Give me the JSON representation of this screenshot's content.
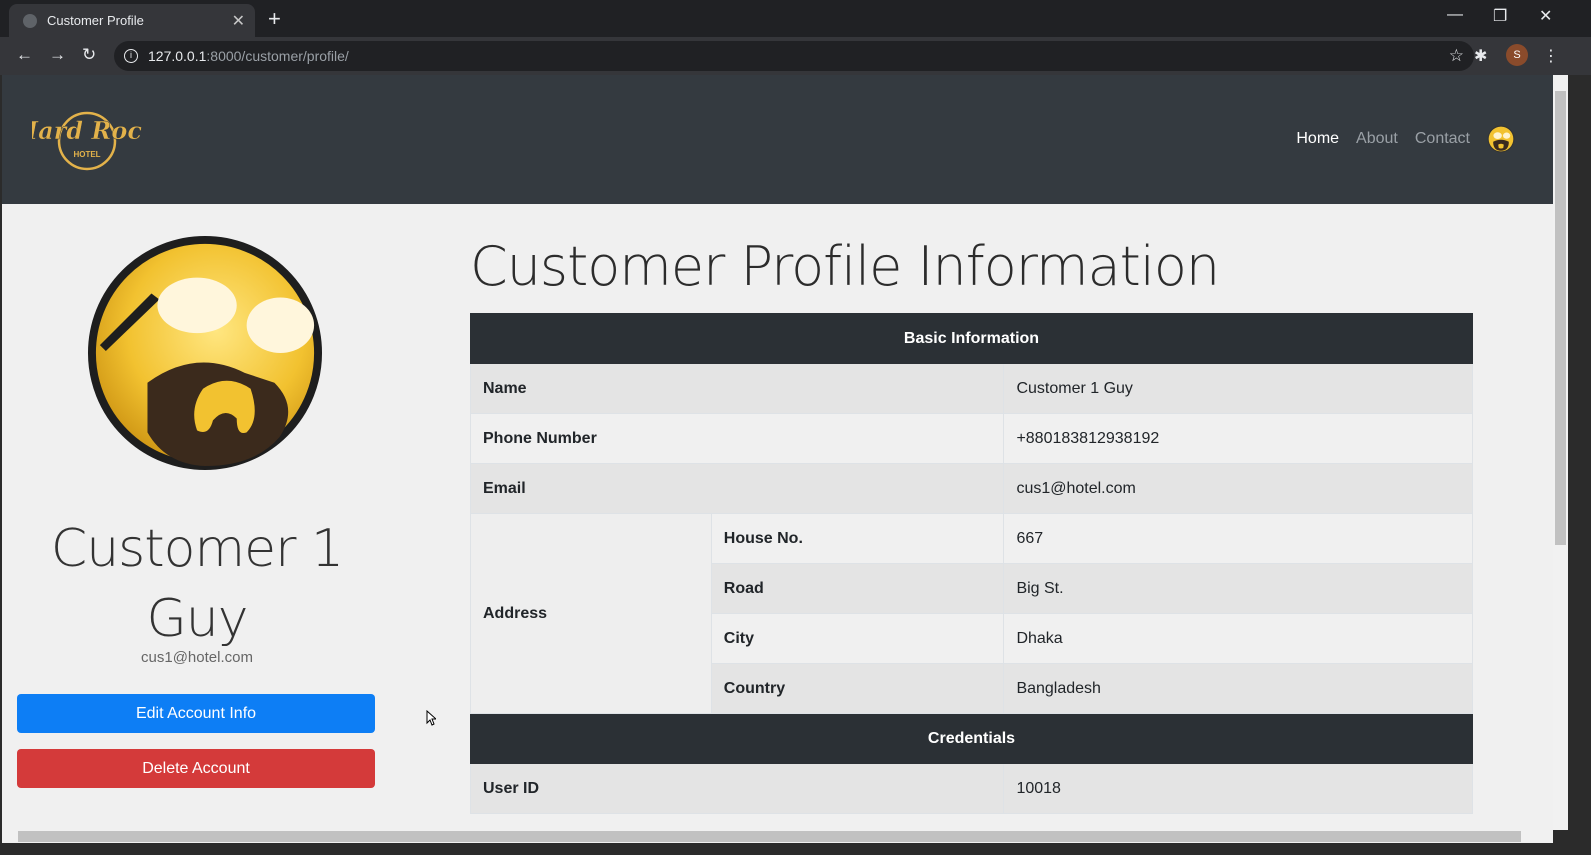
{
  "browser": {
    "tab_title": "Customer Profile",
    "url_host": "127.0.0.1",
    "url_path": ":8000/customer/profile/",
    "profile_initial": "S"
  },
  "nav": {
    "logo_text": "Hard Rock",
    "logo_sub": "HOTEL",
    "links": [
      "Home",
      "About",
      "Contact"
    ]
  },
  "profile": {
    "name": "Customer 1 Guy",
    "name_line1": "Customer 1",
    "name_line2": "Guy",
    "email": "cus1@hotel.com",
    "edit_label": "Edit Account Info",
    "delete_label": "Delete Account"
  },
  "main": {
    "heading": "Customer Profile Information",
    "basic_header": "Basic Information",
    "rows": {
      "name_label": "Name",
      "name_value": "Customer 1 Guy",
      "phone_label": "Phone Number",
      "phone_value": "+880183812938192",
      "email_label": "Email",
      "email_value": "cus1@hotel.com",
      "address_label": "Address",
      "house_label": "House No.",
      "house_value": "667",
      "road_label": "Road",
      "road_value": "Big St.",
      "city_label": "City",
      "city_value": "Dhaka",
      "country_label": "Country",
      "country_value": "Bangladesh"
    },
    "cred_header": "Credentials",
    "userid_label": "User ID",
    "userid_value": "10018"
  },
  "colors": {
    "navbar": "#343a40",
    "edit_button": "#0d7ef5",
    "delete_button": "#d43a3a",
    "table_header": "#2b3035",
    "avatar_yellow": "#f2c230"
  }
}
